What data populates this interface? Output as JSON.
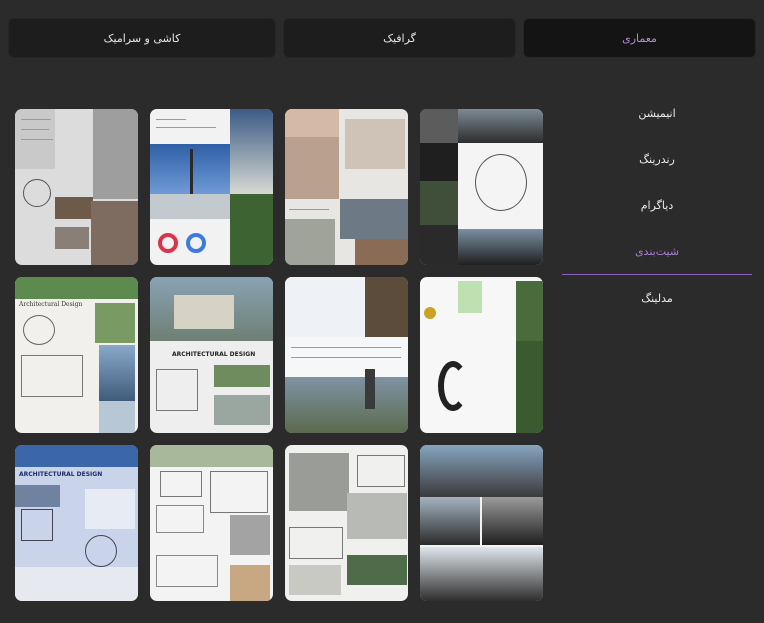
{
  "tabs": [
    {
      "label": "معماری",
      "active": true
    },
    {
      "label": "گرافیک",
      "active": false
    },
    {
      "label": "کاشی و سرامیک",
      "active": false
    }
  ],
  "sidebar": {
    "items": [
      {
        "label": "انیمیشن",
        "active": false
      },
      {
        "label": "رندرینگ",
        "active": false
      },
      {
        "label": "دیاگرام",
        "active": false
      },
      {
        "label": "شیت‌بندی",
        "active": true
      },
      {
        "label": "مدلینگ",
        "active": false
      }
    ]
  },
  "gallery": {
    "items": [
      {
        "theme": "gray-sheet"
      },
      {
        "theme": "blue-sky"
      },
      {
        "theme": "collage"
      },
      {
        "theme": "dark-building"
      },
      {
        "theme": "green-sheet",
        "text": "Architectural Design"
      },
      {
        "theme": "aerial",
        "text": "ARCHITECTURAL DESIGN"
      },
      {
        "theme": "blue-grid"
      },
      {
        "theme": "site-plan"
      },
      {
        "theme": "blue-title",
        "text": "ARCHITECTURAL DESIGN"
      },
      {
        "theme": "white-sheet"
      },
      {
        "theme": "aerial-white"
      },
      {
        "theme": "photo-stack"
      }
    ]
  }
}
